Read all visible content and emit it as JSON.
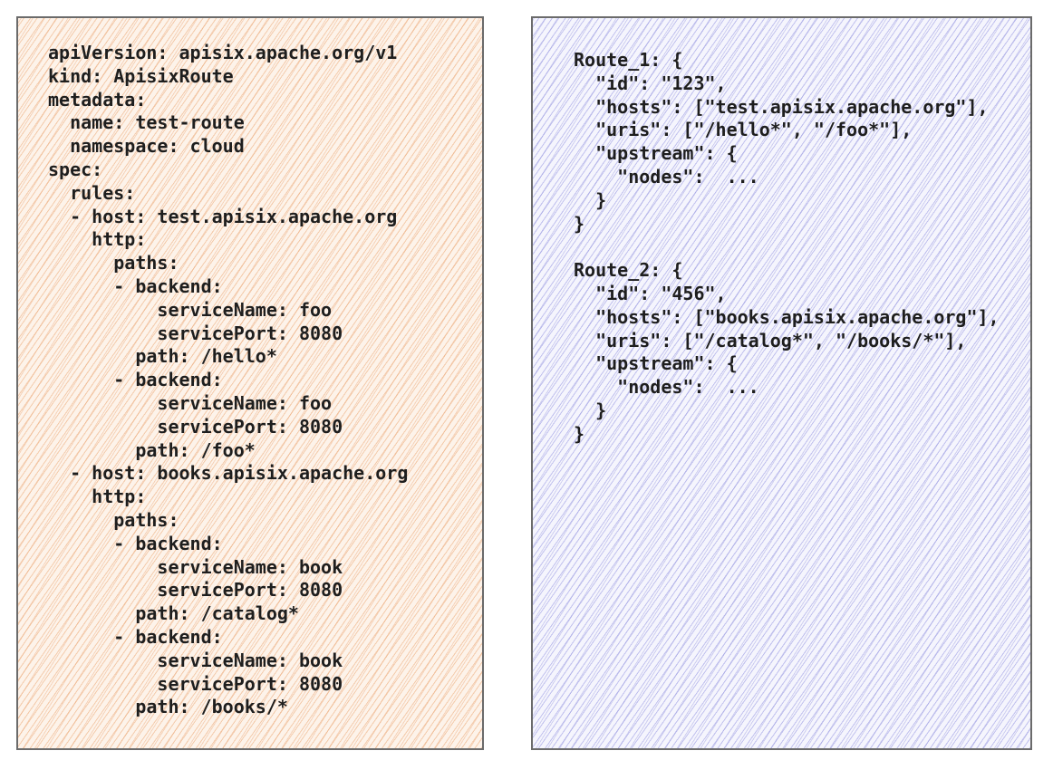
{
  "yaml_panel": {
    "fill_color": "#fdf3ea",
    "hatch_color": "#eca878",
    "lines": [
      "apiVersion: apisix.apache.org/v1",
      "kind: ApisixRoute",
      "metadata:",
      "  name: test-route",
      "  namespace: cloud",
      "spec:",
      "  rules:",
      "  - host: test.apisix.apache.org",
      "    http:",
      "      paths:",
      "      - backend:",
      "          serviceName: foo",
      "          servicePort: 8080",
      "        path: /hello*",
      "      - backend:",
      "          serviceName: foo",
      "          servicePort: 8080",
      "        path: /foo*",
      "  - host: books.apisix.apache.org",
      "    http:",
      "      paths:",
      "      - backend:",
      "          serviceName: book",
      "          servicePort: 8080",
      "        path: /catalog*",
      "      - backend:",
      "          serviceName: book",
      "          servicePort: 8080",
      "        path: /books/*"
    ]
  },
  "json_panel": {
    "fill_color": "#f5f5fd",
    "hatch_color": "#9696e1",
    "lines": [
      "Route_1: {",
      "  \"id\": \"123\",",
      "  \"hosts\": [\"test.apisix.apache.org\"],",
      "  \"uris\": [\"/hello*\", \"/foo*\"],",
      "  \"upstream\": {",
      "    \"nodes\":  ...",
      "  }",
      "}",
      "",
      "Route_2: {",
      "  \"id\": \"456\",",
      "  \"hosts\": [\"books.apisix.apache.org\"],",
      "  \"uris\": [\"/catalog*\", \"/books/*\"],",
      "  \"upstream\": {",
      "    \"nodes\":  ...",
      "  }",
      "}"
    ]
  }
}
